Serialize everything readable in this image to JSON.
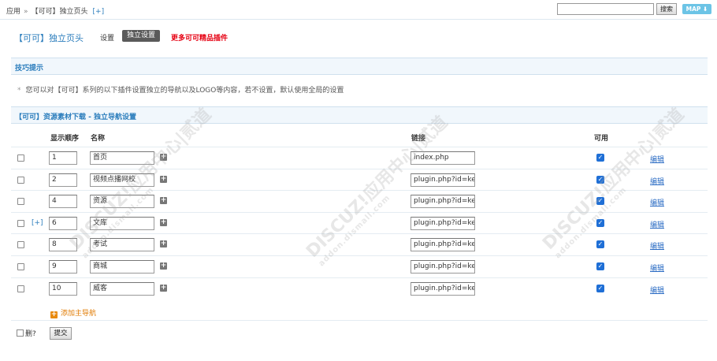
{
  "breadcrumb": {
    "root": "应用",
    "sep": "»",
    "current": "【可可】独立页头",
    "add": "[+]"
  },
  "search": {
    "value": "",
    "button": "搜索"
  },
  "map_button": "MAP",
  "page": {
    "title": "【可可】独立页头",
    "nav_settings": "设置",
    "nav_current": "独立设置",
    "nav_more": "更多可可精品插件"
  },
  "tips": {
    "header": "技巧提示",
    "text": "您可以对【可可】系列的以下插件设置独立的导航以及LOGO等内容，若不设置，默认使用全局的设置"
  },
  "nav_section": {
    "header": "【可可】资源素材下载 - 独立导航设置",
    "columns": {
      "order": "显示顺序",
      "name": "名称",
      "link": "链接",
      "available": "可用"
    },
    "expand_label": "[+]",
    "edit_label": "编辑",
    "rows": [
      {
        "order": "1",
        "name": "首页",
        "link": "index.php",
        "available": true
      },
      {
        "order": "2",
        "name": "视频点播网校",
        "link": "plugin.php?id=ke",
        "available": true
      },
      {
        "order": "4",
        "name": "资源",
        "link": "plugin.php?id=ke",
        "available": true
      },
      {
        "order": "6",
        "name": "文库",
        "link": "plugin.php?id=ke",
        "available": true
      },
      {
        "order": "8",
        "name": "考试",
        "link": "plugin.php?id=ke",
        "available": true
      },
      {
        "order": "9",
        "name": "商城",
        "link": "plugin.php?id=ke",
        "available": true
      },
      {
        "order": "10",
        "name": "威客",
        "link": "plugin.php?id=ke",
        "available": true
      }
    ],
    "add_main_nav": "添加主导航"
  },
  "footer": {
    "delete_label": "删?",
    "submit": "提交"
  },
  "watermark": {
    "brand": "DISCUZ!应用中心|贰道",
    "url": "addon.dismall.com"
  },
  "colors": {
    "accent": "#2b7dbc",
    "more_link": "#e60012",
    "add_link": "#e07a00"
  }
}
